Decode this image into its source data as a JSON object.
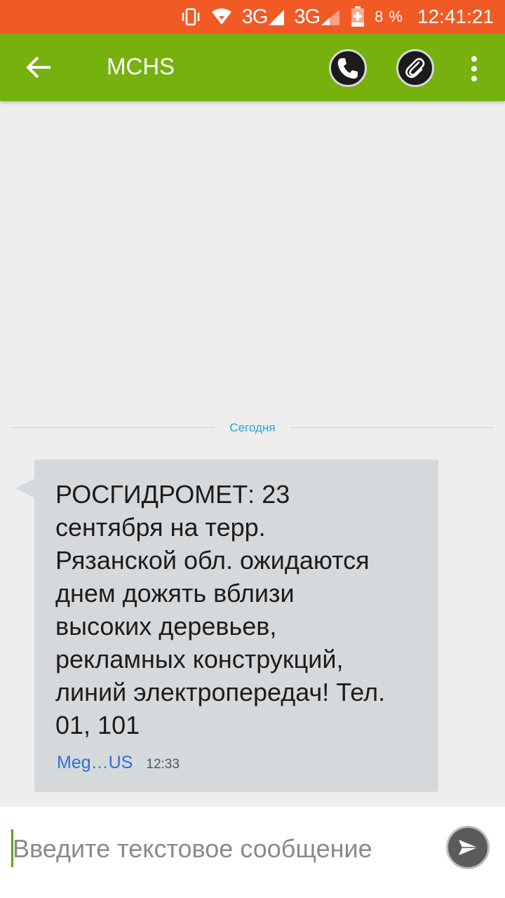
{
  "status_bar": {
    "network_1": "3G",
    "network_2": "3G",
    "battery_percent": "8 %",
    "clock": "12:41:21",
    "icons": [
      "vibrate-icon",
      "wifi-icon",
      "signal-icon",
      "signal-icon",
      "battery-charging-icon"
    ],
    "background_color": "#f15a24"
  },
  "app_bar": {
    "title": "MCHS",
    "icons": [
      "back-arrow-icon",
      "phone-icon",
      "paperclip-icon",
      "overflow-menu-icon"
    ],
    "background_color": "#76b10e"
  },
  "conversation": {
    "date_divider": "Сегодня",
    "messages": [
      {
        "text": "РОСГИДРОМЕТ: 23\nсентября на терр.\nРязанской обл. ожидаются\nднем дожять вблизи\nвысоких деревьев,\nрекламных конструкций,\nлиний электропередач! Тел.\n01, 101",
        "sim": "Meg…US",
        "time": "12:33"
      }
    ]
  },
  "composer": {
    "placeholder": "Введите текстовое сообщение",
    "value": "",
    "send_icon": "send-icon"
  }
}
